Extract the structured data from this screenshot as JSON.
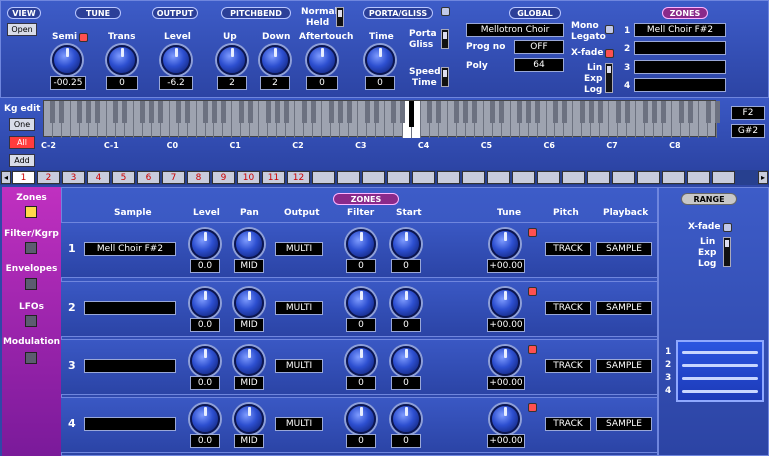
{
  "view": {
    "header": "VIEW",
    "open_label": "Open"
  },
  "tune": {
    "header": "TUNE",
    "semi_label": "Semi",
    "trans_label": "Trans",
    "semi_value": "-00.25",
    "trans_value": "0"
  },
  "output": {
    "header": "OUTPUT",
    "level_label": "Level",
    "level_value": "-6.2"
  },
  "pitchbend": {
    "header": "PITCHBEND",
    "up_label": "Up",
    "down_label": "Down",
    "up_value": "2",
    "down_value": "2",
    "normal_label": "Normal",
    "held_label": "Held",
    "aftertouch_label": "Aftertouch",
    "aftertouch_value": "0"
  },
  "porta": {
    "header": "PORTA/GLISS",
    "time_label": "Time",
    "time_value": "0",
    "porta_label": "Porta",
    "gliss_label": "Gliss",
    "speed_label": "Speed",
    "time2_label": "Time"
  },
  "global": {
    "header": "GLOBAL",
    "preset": "Mellotron Choir",
    "prog_label": "Prog no",
    "prog_value": "OFF",
    "poly_label": "Poly",
    "poly_value": "64",
    "mono_label": "Mono",
    "legato_label": "Legato",
    "xfade_label": "X-fade",
    "lin_label": "Lin",
    "exp_label": "Exp",
    "log_label": "Log"
  },
  "zones_top": {
    "header": "ZONES",
    "slots": [
      {
        "num": "1",
        "name": "Mell Choir F#2"
      },
      {
        "num": "2",
        "name": ""
      },
      {
        "num": "3",
        "name": ""
      },
      {
        "num": "4",
        "name": ""
      }
    ]
  },
  "kg": {
    "label": "Kg edit",
    "one": "One",
    "all": "All",
    "add": "Add",
    "low_key": "F2",
    "high_key": "G#2"
  },
  "octaves": [
    "C-2",
    "C-1",
    "C0",
    "C1",
    "C2",
    "C3",
    "C4",
    "C5",
    "C6",
    "C7",
    "C8"
  ],
  "tabs": [
    "1",
    "2",
    "3",
    "4",
    "5",
    "6",
    "7",
    "8",
    "9",
    "10",
    "11",
    "12"
  ],
  "sidebar": {
    "items": [
      "Zones",
      "Filter/Kgrp",
      "Envelopes",
      "LFOs",
      "Modulation"
    ]
  },
  "zones_main": {
    "header": "ZONES",
    "cols": {
      "sample": "Sample",
      "level": "Level",
      "pan": "Pan",
      "output": "Output",
      "filter": "Filter",
      "start": "Start",
      "tune": "Tune",
      "pitch": "Pitch",
      "playback": "Playback"
    },
    "rows": [
      {
        "num": "1",
        "sample": "Mell Choir F#2",
        "level": "0.0",
        "pan": "MID",
        "output": "MULTI",
        "filter": "0",
        "start": "0",
        "tune": "+00.00",
        "pitch": "TRACK",
        "playback": "SAMPLE"
      },
      {
        "num": "2",
        "sample": "",
        "level": "0.0",
        "pan": "MID",
        "output": "MULTI",
        "filter": "0",
        "start": "0",
        "tune": "+00.00",
        "pitch": "TRACK",
        "playback": "SAMPLE"
      },
      {
        "num": "3",
        "sample": "",
        "level": "0.0",
        "pan": "MID",
        "output": "MULTI",
        "filter": "0",
        "start": "0",
        "tune": "+00.00",
        "pitch": "TRACK",
        "playback": "SAMPLE"
      },
      {
        "num": "4",
        "sample": "",
        "level": "0.0",
        "pan": "MID",
        "output": "MULTI",
        "filter": "0",
        "start": "0",
        "tune": "+00.00",
        "pitch": "TRACK",
        "playback": "SAMPLE"
      }
    ]
  },
  "range": {
    "header": "RANGE",
    "xfade_label": "X-fade",
    "lin_label": "Lin",
    "exp_label": "Exp",
    "log_label": "Log",
    "nums": [
      "1",
      "2",
      "3",
      "4"
    ]
  }
}
